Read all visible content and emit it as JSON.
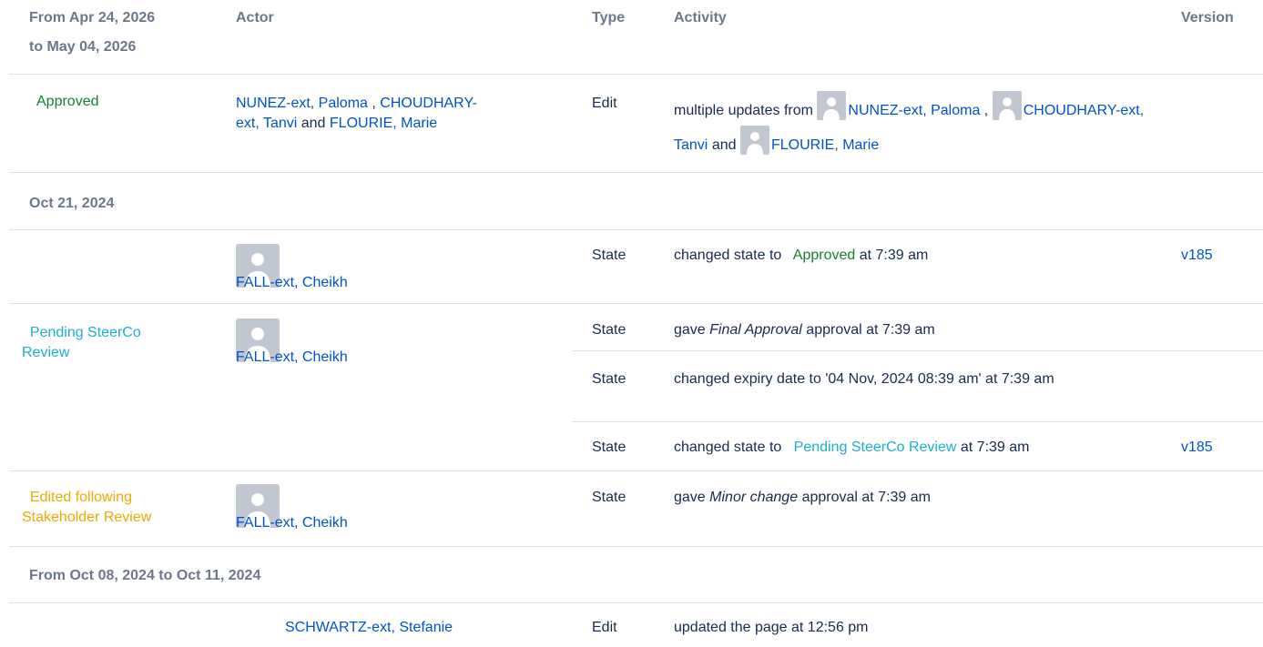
{
  "header": {
    "period": "From Apr 24, 2026 to May 04, 2026",
    "actor": "Actor",
    "type": "Type",
    "activity": "Activity",
    "version": "Version"
  },
  "groups": [
    {
      "date": "From Apr 24, 2026 to May 04, 2026",
      "rows": [
        {
          "state": "Approved",
          "actors_text": [
            "NUNEZ-ext, Paloma",
            "CHOUDHARY-ext, Tanvi",
            "FLOURIE, Marie"
          ],
          "type": "Edit",
          "activity_prefix": "multiple updates from",
          "activity_users": [
            "NUNEZ-ext, Paloma",
            "CHOUDHARY-ext, Tanvi",
            "FLOURIE, Marie"
          ]
        }
      ]
    },
    {
      "date": "Oct 21, 2024",
      "rows": [
        {
          "state": "",
          "actor": "FALL-ext, Cheikh",
          "entries": [
            {
              "type": "State",
              "text_pre": "changed state to",
              "state": "Approved",
              "text_post": "at 7:39 am",
              "version": "v185"
            }
          ]
        },
        {
          "state": "Pending SteerCo Review",
          "actor": "FALL-ext, Cheikh",
          "entries": [
            {
              "type": "State",
              "text_pre": "gave",
              "em": "Final Approval",
              "text_post": "approval at 7:39 am"
            },
            {
              "type": "State",
              "text": "changed expiry date to '04 Nov, 2024 08:39 am' at 7:39 am"
            },
            {
              "type": "State",
              "text_pre": "changed state to",
              "state": "Pending SteerCo Review",
              "text_post": "at 7:39 am",
              "version": "v185"
            }
          ]
        },
        {
          "state": "Edited following Stakeholder Review",
          "actor": "FALL-ext, Cheikh",
          "entries": [
            {
              "type": "State",
              "text_pre": "gave",
              "em": "Minor change",
              "text_post": "approval at 7:39 am"
            }
          ]
        }
      ]
    },
    {
      "date": "From Oct 08, 2024 to Oct 11, 2024",
      "rows": [
        {
          "state": "",
          "actor": "SCHWARTZ-ext, Stefanie",
          "entries": [
            {
              "type": "Edit",
              "text": "updated the page at 12:56 pm"
            }
          ]
        }
      ]
    }
  ],
  "labels": {
    "period_line1": "From Apr 24, 2026",
    "period_line2": "to May 04, 2026",
    "and": "and",
    "comma": ","
  },
  "colors": {
    "link": "#0052cc",
    "approved": "#168032",
    "pending": "#1daed0",
    "edited": "#f2a800",
    "header": "#6b778c",
    "divider": "#dfe1e6"
  }
}
